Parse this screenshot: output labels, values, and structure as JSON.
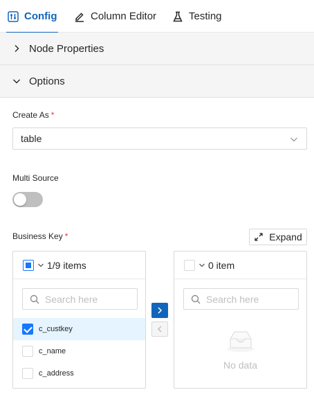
{
  "tabs": [
    {
      "label": "Config",
      "icon": "sliders-icon",
      "active": true
    },
    {
      "label": "Column Editor",
      "icon": "pencil-icon",
      "active": false
    },
    {
      "label": "Testing",
      "icon": "flask-icon",
      "active": false
    }
  ],
  "sections": {
    "node_properties": "Node Properties",
    "options": "Options"
  },
  "create_as": {
    "label": "Create As",
    "required_mark": "*",
    "value": "table"
  },
  "multi_source": {
    "label": "Multi Source",
    "enabled": false
  },
  "business_key": {
    "label": "Business Key",
    "required_mark": "*",
    "expand_label": "Expand",
    "source": {
      "count_text": "1/9 items",
      "search_placeholder": "Search here",
      "items": [
        {
          "label": "c_custkey",
          "checked": true
        },
        {
          "label": "c_name",
          "checked": false
        },
        {
          "label": "c_address",
          "checked": false
        }
      ]
    },
    "target": {
      "count_text": "0 item",
      "search_placeholder": "Search here",
      "empty_text": "No data"
    }
  },
  "colors": {
    "accent": "#1166bb",
    "checkbox": "#1677ff",
    "required": "#e53935",
    "selected_row": "#e6f4ff"
  }
}
